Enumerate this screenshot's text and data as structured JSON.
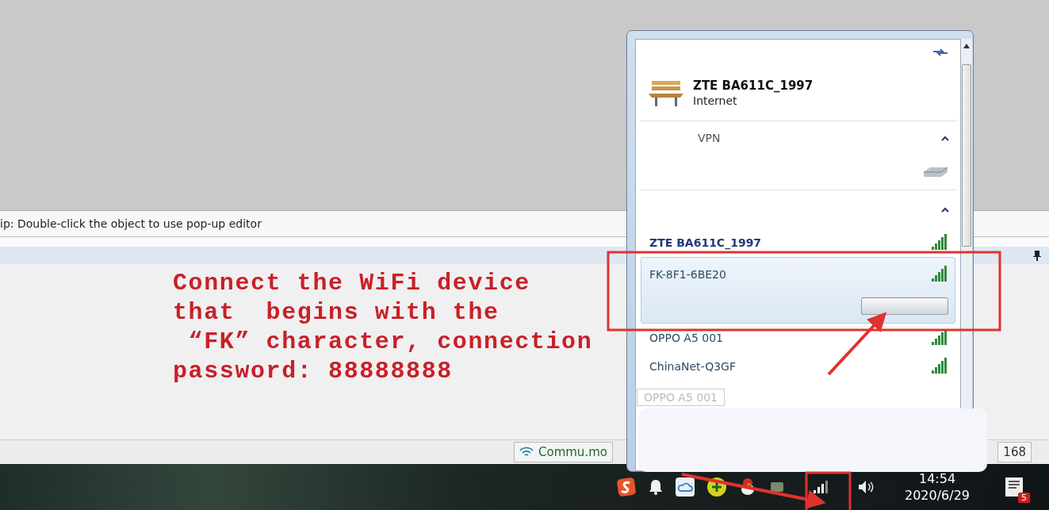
{
  "background_app": {
    "tip": "ip: Double-click the object to use pop-up editor",
    "annotation": [
      "Connect the WiFi device",
      "that  begins with the",
      " “FK” character, connection",
      "password: 88888888"
    ],
    "status_bar": {
      "item": "Commu.mo",
      "item_2": "168"
    }
  },
  "network_popup": {
    "connection": {
      "name": "ZTE BA611C_1997",
      "status": "Internet"
    },
    "vpn_section": {
      "label": "VPN",
      "expanded": true
    },
    "wireless_section": {
      "expanded": true
    },
    "networks": [
      {
        "name": "ZTE BA611C_1997",
        "selected": false
      },
      {
        "name": "FK-8F1-6BE20",
        "selected": true
      },
      {
        "name": "OPPO A5 001",
        "selected": false
      },
      {
        "name": "ChinaNet-Q3GF",
        "selected": false
      }
    ],
    "tooltip": "OPPO A5 001"
  },
  "taskbar": {
    "time": "14:54",
    "date": "2020/6/29",
    "notification_count": "5"
  }
}
